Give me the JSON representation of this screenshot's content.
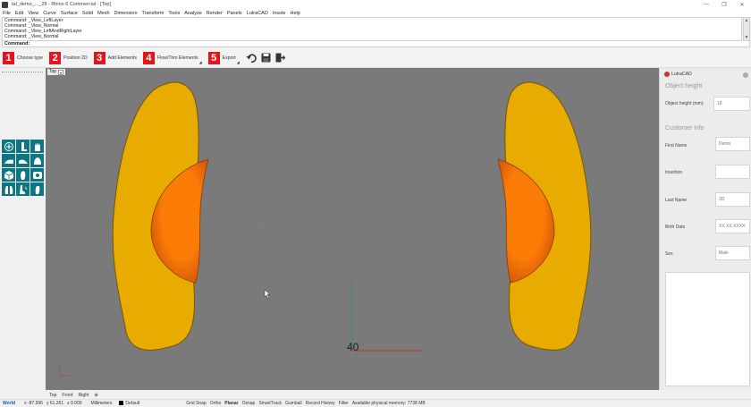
{
  "window": {
    "title": "tal_demo_..._28 - Rhino 6 Commercial - [Top]",
    "min_glyph": "—",
    "max_glyph": "❐",
    "close_glyph": "✕"
  },
  "menu": [
    "File",
    "Edit",
    "View",
    "Curve",
    "Surface",
    "Solid",
    "Mesh",
    "Dimension",
    "Transform",
    "Tools",
    "Analyze",
    "Render",
    "Panels",
    "LutraCAD",
    "Insole",
    "Help"
  ],
  "command_history": [
    "Command: _View_LeftLayer",
    "Command: _View_Normal",
    "Command: _View_LeftAndRightLayer",
    "Command: _View_Normal"
  ],
  "command_prompt": "Command:",
  "steps": [
    {
      "num": "1",
      "label": "Choose type"
    },
    {
      "num": "2",
      "label": "Position 2D"
    },
    {
      "num": "3",
      "label": "Add Elements"
    },
    {
      "num": "4",
      "label": "Flow/Trim Elements"
    },
    {
      "num": "5",
      "label": "Export"
    }
  ],
  "toolbar_icons": [
    "undo-icon",
    "save-icon",
    "exit-icon"
  ],
  "left_tools": [
    "foot-circle-icon",
    "foot-side-icon",
    "hand-icon",
    "heel-left-icon",
    "heel-right-icon",
    "foot-view-icon",
    "cube-icon",
    "insole-icon",
    "layer-icon",
    "foot-pair-icon",
    "shoe-icon",
    "foot-right-icon"
  ],
  "viewport": {
    "label": "Top",
    "dropdown_glyph": "▾",
    "axis_label": "40",
    "colors": {
      "background": "#7a7a7a",
      "insole": "#e8ac00",
      "insole_outline": "#7a5600",
      "pad": "#fb7c06",
      "pad_dark": "#d4570a",
      "x_axis": "#c0392b",
      "y_axis": "#2d8c8c"
    }
  },
  "viewport_tabs": [
    "Top",
    "Front",
    "Right",
    "⊕"
  ],
  "status": {
    "world": "World",
    "x": "x -87.996",
    "y": "y 61.261",
    "z": "z 0.000",
    "units": "Millimeters",
    "layer": "Default",
    "grid_snap": "Grid Snap",
    "ortho": "Ortho",
    "planar": "Planar",
    "osnap": "Osnap",
    "smarttrack": "SmartTrack",
    "gumball": "Gumball",
    "record_history": "Record History",
    "filter": "Filter",
    "memory": "Available physical memory: 7738 MB"
  },
  "panel": {
    "title": "LutraCAD",
    "section_object": "Object height",
    "object_height_label": "Object height (mm)",
    "object_height_value": "18",
    "section_customer": "Customer info",
    "first_name_label": "First Name",
    "first_name_value": "Demo",
    "insertion_label": "Insertion",
    "insertion_value": "",
    "last_name_label": "Last Name",
    "last_name_value": "3D",
    "birth_date_label": "Birth Date",
    "birth_date_value": "XX.XX.XXXX",
    "sex_label": "Sex",
    "sex_value": "Male"
  }
}
